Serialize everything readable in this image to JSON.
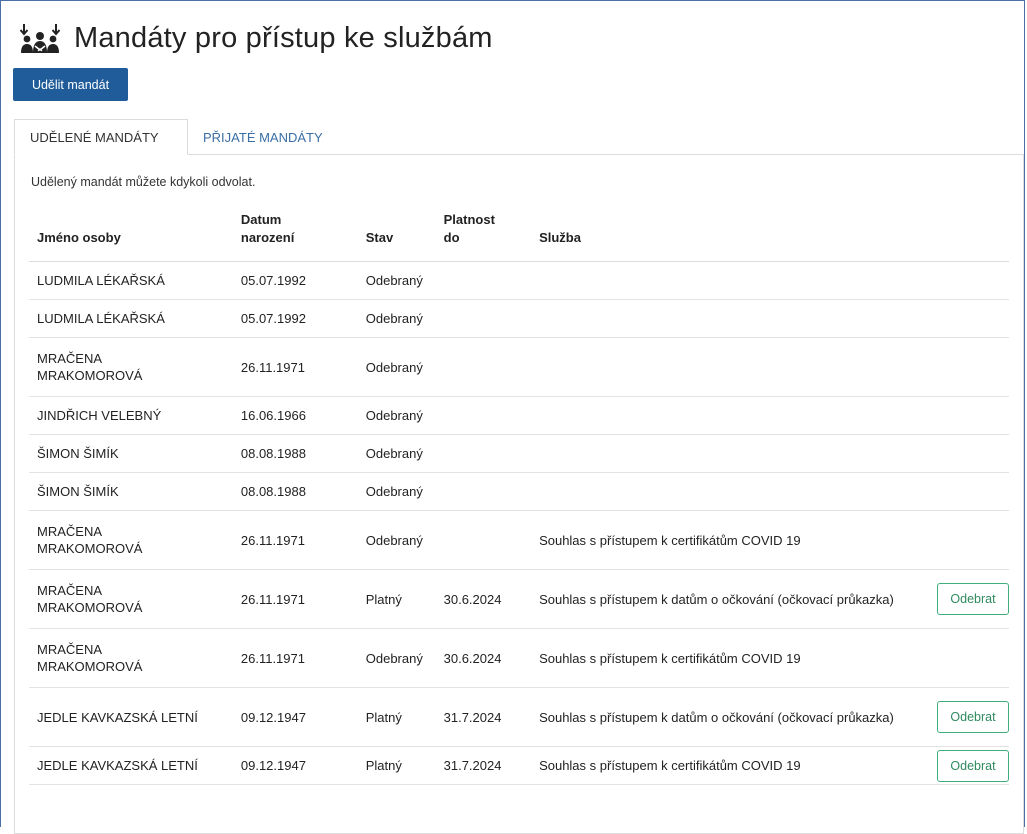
{
  "page": {
    "title": "Mandáty pro přístup ke službám",
    "icon": "people-arrows-icon"
  },
  "toolbar": {
    "grant_label": "Udělit mandát"
  },
  "tabs": [
    {
      "label": "UDĚLENÉ MANDÁTY",
      "active": true
    },
    {
      "label": "PŘIJATÉ MANDÁTY",
      "active": false
    }
  ],
  "panel": {
    "hint": "Udělený mandát můžete kdykoli odvolat."
  },
  "table": {
    "headers": {
      "name": "Jméno osoby",
      "birth_line1": "Datum",
      "birth_line2": "narození",
      "state": "Stav",
      "valid_line1": "Platnost",
      "valid_line2": "do",
      "service": "Služba"
    },
    "rows": [
      {
        "name": "LUDMILA LÉKAŘSKÁ",
        "birth": "05.07.1992",
        "state": "Odebraný",
        "valid": "",
        "service": "",
        "action": ""
      },
      {
        "name": "LUDMILA LÉKAŘSKÁ",
        "birth": "05.07.1992",
        "state": "Odebraný",
        "valid": "",
        "service": "",
        "action": ""
      },
      {
        "name": "MRAČENA MRAKOMOROVÁ",
        "birth": "26.11.1971",
        "state": "Odebraný",
        "valid": "",
        "service": "",
        "action": ""
      },
      {
        "name": "JINDŘICH VELEBNÝ",
        "birth": "16.06.1966",
        "state": "Odebraný",
        "valid": "",
        "service": "",
        "action": ""
      },
      {
        "name": "ŠIMON ŠIMÍK",
        "birth": "08.08.1988",
        "state": "Odebraný",
        "valid": "",
        "service": "",
        "action": ""
      },
      {
        "name": "ŠIMON ŠIMÍK",
        "birth": "08.08.1988",
        "state": "Odebraný",
        "valid": "",
        "service": "",
        "action": ""
      },
      {
        "name": "MRAČENA MRAKOMOROVÁ",
        "birth": "26.11.1971",
        "state": "Odebraný",
        "valid": "",
        "service": "Souhlas s přístupem k certifikátům COVID 19",
        "action": ""
      },
      {
        "name": "MRAČENA MRAKOMOROVÁ",
        "birth": "26.11.1971",
        "state": "Platný",
        "valid": "30.6.2024",
        "service": "Souhlas s přístupem k datům o očkování (očkovací průkazka)",
        "action": "Odebrat"
      },
      {
        "name": "MRAČENA MRAKOMOROVÁ",
        "birth": "26.11.1971",
        "state": "Odebraný",
        "valid": "30.6.2024",
        "service": "Souhlas s přístupem k certifikátům COVID 19",
        "action": ""
      },
      {
        "name": "JEDLE KAVKAZSKÁ LETNÍ",
        "birth": "09.12.1947",
        "state": "Platný",
        "valid": "31.7.2024",
        "service": "Souhlas s přístupem k datům o očkování (očkovací průkazka)",
        "action": "Odebrat"
      },
      {
        "name": "JEDLE KAVKAZSKÁ LETNÍ",
        "birth": "09.12.1947",
        "state": "Platný",
        "valid": "31.7.2024",
        "service": "Souhlas s přístupem k certifikátům COVID 19",
        "action": "Odebrat"
      }
    ]
  },
  "colors": {
    "primary": "#1f5c99",
    "tab_link": "#3a6ea5",
    "success_border": "#3fae7c",
    "success_text": "#2f8a5f"
  }
}
